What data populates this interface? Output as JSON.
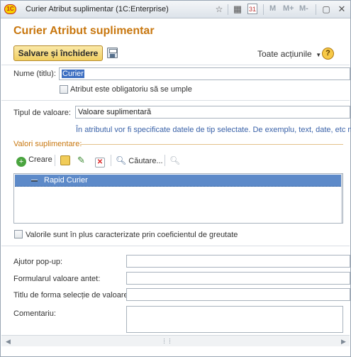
{
  "window": {
    "title": "Curier Atribut suplimentar  (1C:Enterprise)",
    "logo_text": "1C",
    "memory_buttons": [
      "M",
      "M+",
      "M-"
    ],
    "calendar_day": "31"
  },
  "form": {
    "title": "Curier Atribut suplimentar",
    "save_close_label": "Salvare și închidere",
    "all_actions_label": "Toate acțiunile",
    "help_label": "?"
  },
  "fields": {
    "name_label": "Nume (titlu):",
    "name_value": "Curier",
    "required_label": "Atribut este obligatoriu să se umple",
    "value_type_label": "Tipul de valoare:",
    "value_type_value": "Valoare suplimentară",
    "value_type_hint": "În atributul vor fi specificate datele de tip selectate. De exemplu, text, date, etc nu"
  },
  "values_group": {
    "title": "Valori suplimentare:",
    "toolbar": {
      "create_label": "Creare",
      "search_label": "Căutare..."
    },
    "rows": [
      {
        "label": "Rapid Curier"
      }
    ]
  },
  "weight_checkbox_label": "Valorile sunt în plus caracterizate prin coeficientul de greutate",
  "extra": {
    "popup_help_label": "Ajutor pop-up:",
    "header_form_label": "Formularul valoare antet:",
    "selection_form_title_label": "Titlu de forma selecție de valoare:",
    "comment_label": "Comentariu:"
  },
  "colors": {
    "accent_orange": "#c8770f",
    "selection_blue": "#5d8ac9",
    "hint_blue": "#3a62a8"
  }
}
